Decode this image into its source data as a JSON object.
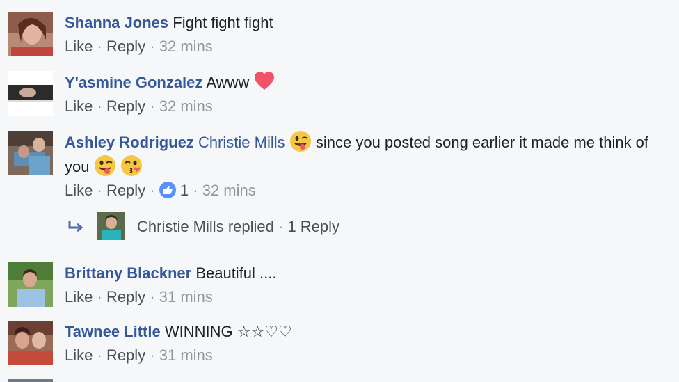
{
  "comments": [
    {
      "author": "Shanna Jones",
      "text": "Fight fight fight",
      "like_label": "Like",
      "reply_label": "Reply",
      "time": "32 mins"
    },
    {
      "author": "Y'asmine Gonzalez",
      "text": "Awww",
      "trailing_emoji": "heart-emoji",
      "like_label": "Like",
      "reply_label": "Reply",
      "time": "32 mins"
    },
    {
      "author": "Ashley Rodriguez",
      "mention": "Christie Mills",
      "text_after_mention": "since you posted song earlier it made me think of you",
      "emojis": [
        "winking-tongue-emoji",
        "winking-tongue-emoji",
        "kissing-wink-emoji"
      ],
      "like_label": "Like",
      "reply_label": "Reply",
      "like_count": "1",
      "time": "32 mins"
    },
    {
      "author": "Brittany Blackner",
      "text": "Beautiful ....",
      "like_label": "Like",
      "reply_label": "Reply",
      "time": "31 mins"
    },
    {
      "author": "Tawnee Little",
      "text": "WINNING ☆☆♡♡",
      "like_label": "Like",
      "reply_label": "Reply",
      "time": "31 mins"
    }
  ],
  "reply_summary": {
    "name": "Christie Mills",
    "replied_text": "replied",
    "count_text": "1 Reply",
    "icon": "reply-arrow-icon"
  },
  "separator": "·",
  "colors": {
    "author": "#365899",
    "meta": "#90949c",
    "action": "#4b4f56",
    "background": "#f6f7f9",
    "like_badge": "#5890ff"
  }
}
